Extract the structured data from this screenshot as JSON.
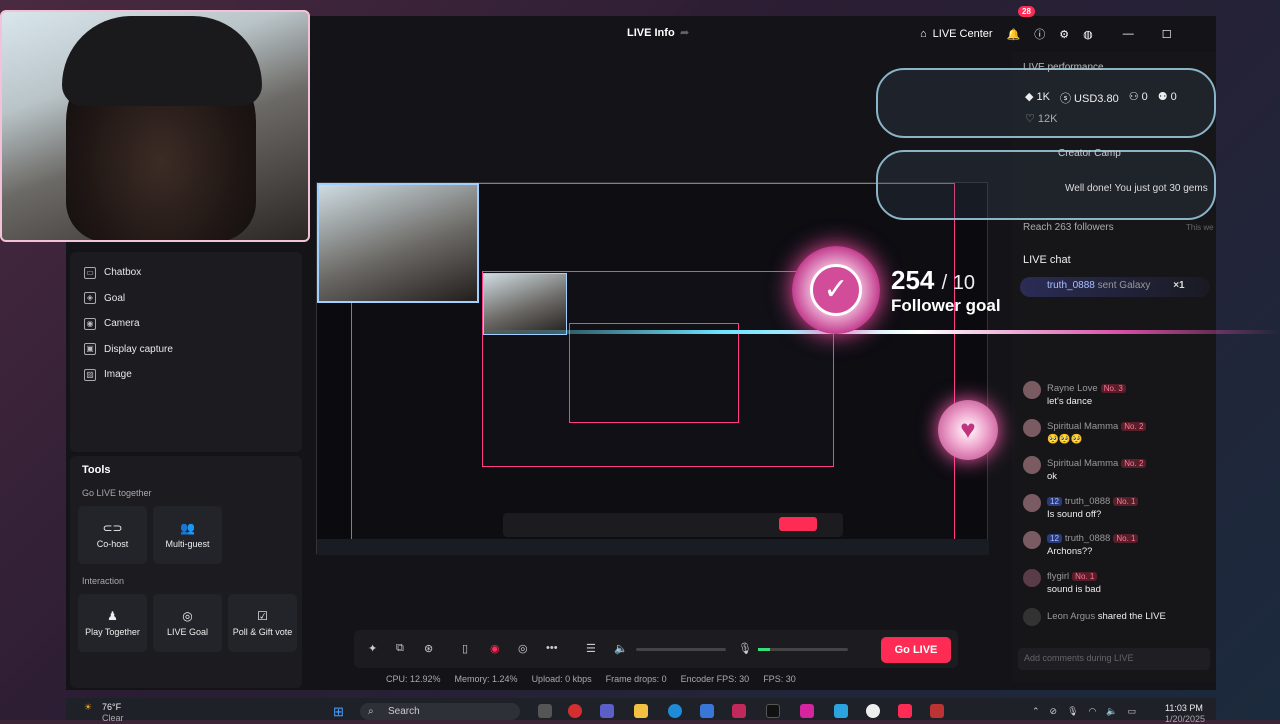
{
  "header": {
    "title": "LIVE Info",
    "live_center": "LIVE Center",
    "notif_count": "28"
  },
  "sources": [
    {
      "label": "Chatbox",
      "icon": "chat-icon"
    },
    {
      "label": "Goal",
      "icon": "goal-icon"
    },
    {
      "label": "Camera",
      "icon": "camera-icon"
    },
    {
      "label": "Display capture",
      "icon": "display-icon"
    },
    {
      "label": "Image",
      "icon": "image-icon"
    }
  ],
  "tools": {
    "title": "Tools",
    "go_live_together": "Go LIVE together",
    "cohost": "Co-host",
    "multiguest": "Multi-guest",
    "interaction": "Interaction",
    "play_together": "Play Together",
    "live_goal": "LIVE Goal",
    "poll": "Poll & Gift vote"
  },
  "performance": {
    "title": "LIVE performance",
    "diamonds": "1K",
    "usd": "USD3.80",
    "viewers": "0",
    "follows": "0",
    "likes": "12K"
  },
  "creator_camp": {
    "title": "Creator Camp",
    "gems": "Well done! You just got 30 gems",
    "reach": "Reach 263 followers",
    "reach2": "This we"
  },
  "goal": {
    "current": "254",
    "slash": "/ 10",
    "label": "Follower goal"
  },
  "chat": {
    "title": "LIVE chat",
    "gift": {
      "user": "truth_0888",
      "text": "sent Galaxy",
      "count": "×1"
    },
    "messages": [
      {
        "user": "Rayne Love",
        "rank": "No. 3",
        "text": "let's dance"
      },
      {
        "user": "Spiritual Mamma",
        "rank": "No. 2",
        "text": "🥺🥺🥺"
      },
      {
        "user": "Spiritual Mamma",
        "rank": "No. 2",
        "text": "ok"
      },
      {
        "user": "truth_0888",
        "level": "12",
        "rank": "No. 1",
        "text": "Is sound off?"
      },
      {
        "user": "truth_0888",
        "level": "12",
        "rank": "No. 1",
        "text": "Archons??"
      },
      {
        "user": "flygirl",
        "rank": "No. 1",
        "text": "sound is bad"
      },
      {
        "user": "Leon Argus",
        "rank": "",
        "text": "shared the LIVE"
      }
    ],
    "placeholder": "Add comments during LIVE"
  },
  "controls": {
    "go_live": "Go LIVE"
  },
  "stats": {
    "cpu": "CPU: 12.92%",
    "memory": "Memory: 1.24%",
    "upload": "Upload: 0 kbps",
    "frame_drops": "Frame drops: 0",
    "encoder": "Encoder FPS: 30",
    "fps": "FPS: 30"
  },
  "taskbar": {
    "temp": "76°F",
    "weather": "Clear",
    "search": "Search",
    "time": "11:03 PM",
    "date": "1/20/2025"
  },
  "colors": {
    "accent": "#fe2c55",
    "pink_glow": "#ff4fa8"
  }
}
